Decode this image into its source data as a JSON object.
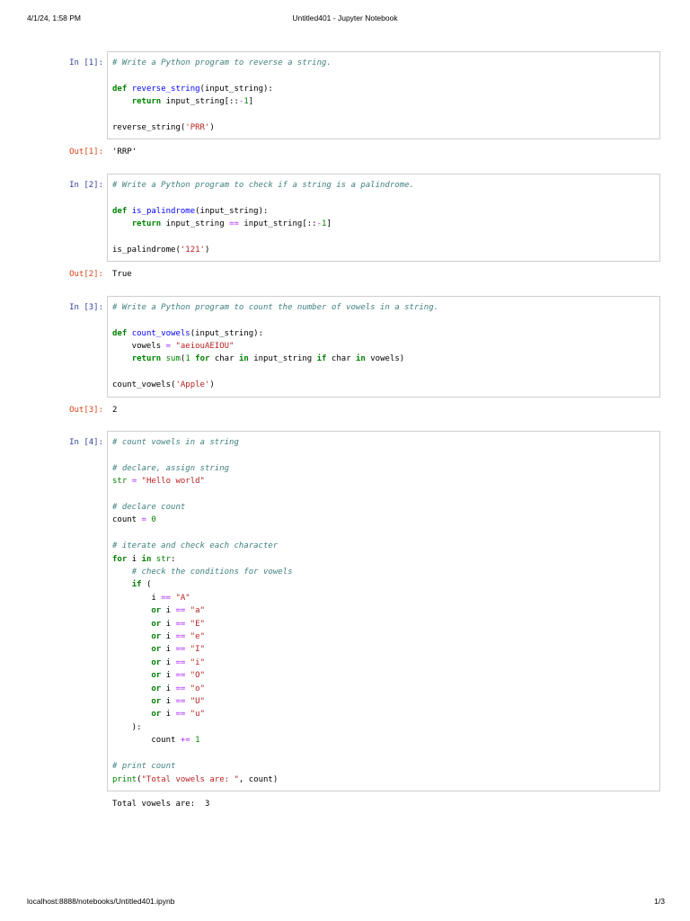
{
  "header": {
    "datetime": "4/1/24, 1:58 PM",
    "title": "Untitled401 - Jupyter Notebook"
  },
  "footer": {
    "url": "localhost:8888/notebooks/Untitled401.ipynb",
    "page_number": "1/3"
  },
  "colors": {
    "in_prompt": "#303F9F",
    "out_prompt": "#D84315",
    "keyword": "#008000",
    "builtin": "#008000",
    "comment": "#408080",
    "string": "#BA2121",
    "number": "#008800",
    "operator": "#AA22FF",
    "function_def": "#0000FF",
    "cell_border": "#CFCFCF",
    "text": "#000000"
  },
  "cells": [
    {
      "kind": "code",
      "in_prompt": "In [1]:",
      "code": [
        [
          [
            "com",
            "# Write a Python program to reverse a string."
          ]
        ],
        [],
        [
          [
            "kw",
            "def"
          ],
          [
            "pl",
            " "
          ],
          [
            "df",
            "reverse_string"
          ],
          [
            "pl",
            "(input_string):"
          ]
        ],
        [
          [
            "pl",
            "    "
          ],
          [
            "kw",
            "return"
          ],
          [
            "pl",
            " input_string[::"
          ],
          [
            "op",
            "-"
          ],
          [
            "num",
            "1"
          ],
          [
            "pl",
            "]"
          ]
        ],
        [],
        [
          [
            "pl",
            "reverse_string("
          ],
          [
            "str",
            "'PRR'"
          ],
          [
            "pl",
            ")"
          ]
        ]
      ],
      "out_prompt": "Out[1]:",
      "out_text": "'RRP'"
    },
    {
      "kind": "code",
      "in_prompt": "In [2]:",
      "code": [
        [
          [
            "com",
            "# Write a Python program to check if a string is a palindrome."
          ]
        ],
        [],
        [
          [
            "kw",
            "def"
          ],
          [
            "pl",
            " "
          ],
          [
            "df",
            "is_palindrome"
          ],
          [
            "pl",
            "(input_string):"
          ]
        ],
        [
          [
            "pl",
            "    "
          ],
          [
            "kw",
            "return"
          ],
          [
            "pl",
            " input_string "
          ],
          [
            "op",
            "=="
          ],
          [
            "pl",
            " input_string[::"
          ],
          [
            "op",
            "-"
          ],
          [
            "num",
            "1"
          ],
          [
            "pl",
            "]"
          ]
        ],
        [],
        [
          [
            "pl",
            "is_palindrome("
          ],
          [
            "str",
            "'121'"
          ],
          [
            "pl",
            ")"
          ]
        ]
      ],
      "out_prompt": "Out[2]:",
      "out_text": "True"
    },
    {
      "kind": "code",
      "in_prompt": "In [3]:",
      "code": [
        [
          [
            "com",
            "# Write a Python program to count the number of vowels in a string."
          ]
        ],
        [],
        [
          [
            "kw",
            "def"
          ],
          [
            "pl",
            " "
          ],
          [
            "df",
            "count_vowels"
          ],
          [
            "pl",
            "(input_string):"
          ]
        ],
        [
          [
            "pl",
            "    vowels "
          ],
          [
            "op",
            "="
          ],
          [
            "pl",
            " "
          ],
          [
            "str",
            "\"aeiouAEIOU\""
          ]
        ],
        [
          [
            "pl",
            "    "
          ],
          [
            "kw",
            "return"
          ],
          [
            "pl",
            " "
          ],
          [
            "bi",
            "sum"
          ],
          [
            "pl",
            "("
          ],
          [
            "num",
            "1"
          ],
          [
            "pl",
            " "
          ],
          [
            "kw",
            "for"
          ],
          [
            "pl",
            " char "
          ],
          [
            "kw",
            "in"
          ],
          [
            "pl",
            " input_string "
          ],
          [
            "kw",
            "if"
          ],
          [
            "pl",
            " char "
          ],
          [
            "kw",
            "in"
          ],
          [
            "pl",
            " vowels)"
          ]
        ],
        [],
        [
          [
            "pl",
            "count_vowels("
          ],
          [
            "str",
            "'Apple'"
          ],
          [
            "pl",
            ")"
          ]
        ]
      ],
      "out_prompt": "Out[3]:",
      "out_text": "2"
    },
    {
      "kind": "code",
      "in_prompt": "In [4]:",
      "code": [
        [
          [
            "com",
            "# count vowels in a string"
          ]
        ],
        [],
        [
          [
            "com",
            "# declare, assign string"
          ]
        ],
        [
          [
            "bi",
            "str"
          ],
          [
            "pl",
            " "
          ],
          [
            "op",
            "="
          ],
          [
            "pl",
            " "
          ],
          [
            "str",
            "\"Hello world\""
          ]
        ],
        [],
        [
          [
            "com",
            "# declare count"
          ]
        ],
        [
          [
            "pl",
            "count "
          ],
          [
            "op",
            "="
          ],
          [
            "pl",
            " "
          ],
          [
            "num",
            "0"
          ]
        ],
        [],
        [
          [
            "com",
            "# iterate and check each character"
          ]
        ],
        [
          [
            "kw",
            "for"
          ],
          [
            "pl",
            " i "
          ],
          [
            "kw",
            "in"
          ],
          [
            "pl",
            " "
          ],
          [
            "bi",
            "str"
          ],
          [
            "pl",
            ":"
          ]
        ],
        [
          [
            "pl",
            "    "
          ],
          [
            "com",
            "# check the conditions for vowels"
          ]
        ],
        [
          [
            "pl",
            "    "
          ],
          [
            "kw",
            "if"
          ],
          [
            "pl",
            " ("
          ]
        ],
        [
          [
            "pl",
            "        i "
          ],
          [
            "op",
            "=="
          ],
          [
            "pl",
            " "
          ],
          [
            "str",
            "\"A\""
          ]
        ],
        [
          [
            "pl",
            "        "
          ],
          [
            "kw",
            "or"
          ],
          [
            "pl",
            " i "
          ],
          [
            "op",
            "=="
          ],
          [
            "pl",
            " "
          ],
          [
            "str",
            "\"a\""
          ]
        ],
        [
          [
            "pl",
            "        "
          ],
          [
            "kw",
            "or"
          ],
          [
            "pl",
            " i "
          ],
          [
            "op",
            "=="
          ],
          [
            "pl",
            " "
          ],
          [
            "str",
            "\"E\""
          ]
        ],
        [
          [
            "pl",
            "        "
          ],
          [
            "kw",
            "or"
          ],
          [
            "pl",
            " i "
          ],
          [
            "op",
            "=="
          ],
          [
            "pl",
            " "
          ],
          [
            "str",
            "\"e\""
          ]
        ],
        [
          [
            "pl",
            "        "
          ],
          [
            "kw",
            "or"
          ],
          [
            "pl",
            " i "
          ],
          [
            "op",
            "=="
          ],
          [
            "pl",
            " "
          ],
          [
            "str",
            "\"I\""
          ]
        ],
        [
          [
            "pl",
            "        "
          ],
          [
            "kw",
            "or"
          ],
          [
            "pl",
            " i "
          ],
          [
            "op",
            "=="
          ],
          [
            "pl",
            " "
          ],
          [
            "str",
            "\"i\""
          ]
        ],
        [
          [
            "pl",
            "        "
          ],
          [
            "kw",
            "or"
          ],
          [
            "pl",
            " i "
          ],
          [
            "op",
            "=="
          ],
          [
            "pl",
            " "
          ],
          [
            "str",
            "\"O\""
          ]
        ],
        [
          [
            "pl",
            "        "
          ],
          [
            "kw",
            "or"
          ],
          [
            "pl",
            " i "
          ],
          [
            "op",
            "=="
          ],
          [
            "pl",
            " "
          ],
          [
            "str",
            "\"o\""
          ]
        ],
        [
          [
            "pl",
            "        "
          ],
          [
            "kw",
            "or"
          ],
          [
            "pl",
            " i "
          ],
          [
            "op",
            "=="
          ],
          [
            "pl",
            " "
          ],
          [
            "str",
            "\"U\""
          ]
        ],
        [
          [
            "pl",
            "        "
          ],
          [
            "kw",
            "or"
          ],
          [
            "pl",
            " i "
          ],
          [
            "op",
            "=="
          ],
          [
            "pl",
            " "
          ],
          [
            "str",
            "\"u\""
          ]
        ],
        [
          [
            "pl",
            "    ):"
          ]
        ],
        [
          [
            "pl",
            "        count "
          ],
          [
            "op",
            "+="
          ],
          [
            "pl",
            " "
          ],
          [
            "num",
            "1"
          ]
        ],
        [],
        [
          [
            "com",
            "# print count"
          ]
        ],
        [
          [
            "bi",
            "print"
          ],
          [
            "pl",
            "("
          ],
          [
            "str",
            "\"Total vowels are: \""
          ],
          [
            "pl",
            ", count)"
          ]
        ]
      ],
      "stream_text": "Total vowels are:  3"
    }
  ]
}
